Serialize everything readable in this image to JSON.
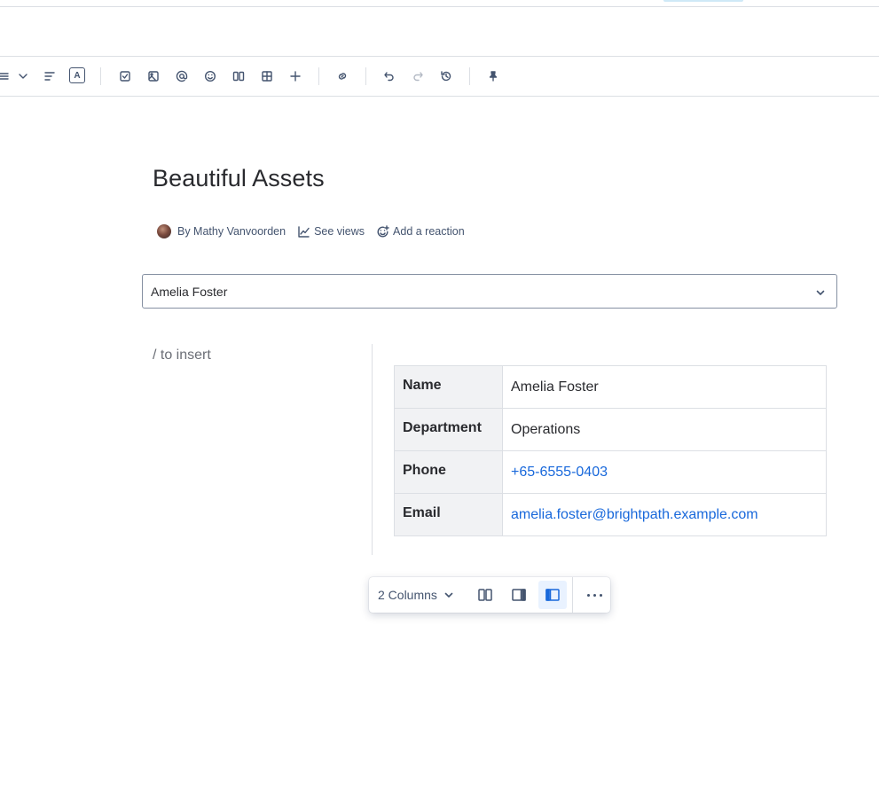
{
  "toolbar": {
    "text_color_label": "A",
    "items": [
      "list-icon",
      "chevron-down-icon",
      "align-icon",
      "text-color-icon",
      "task-icon",
      "image-icon",
      "mention-icon",
      "emoji-icon",
      "layout-icon",
      "table-icon",
      "plus-icon",
      "link-icon",
      "undo-icon",
      "redo-icon",
      "history-icon",
      "pin-icon"
    ]
  },
  "page": {
    "title": "Beautiful Assets",
    "byline": {
      "author": "By Mathy Vanvoorden",
      "see_views": "See views",
      "add_reaction": "Add a reaction"
    }
  },
  "selector": {
    "value": "Amelia Foster"
  },
  "columns": {
    "placeholder": "/ to insert",
    "table": [
      {
        "label": "Name",
        "value": "Amelia Foster"
      },
      {
        "label": "Department",
        "value": "Operations"
      },
      {
        "label": "Phone",
        "value": "+65-6555-0403"
      },
      {
        "label": "Email",
        "value": "amelia.foster@brightpath.example.com"
      }
    ]
  },
  "layout_toolbar": {
    "columns_label": "2 Columns",
    "active_layout": "left-sidebar"
  },
  "colors": {
    "link": "#1868db",
    "text": "#292a2e",
    "subtle": "#44546f",
    "border": "#dcdfe4",
    "active_bg": "#e9f2ff"
  }
}
